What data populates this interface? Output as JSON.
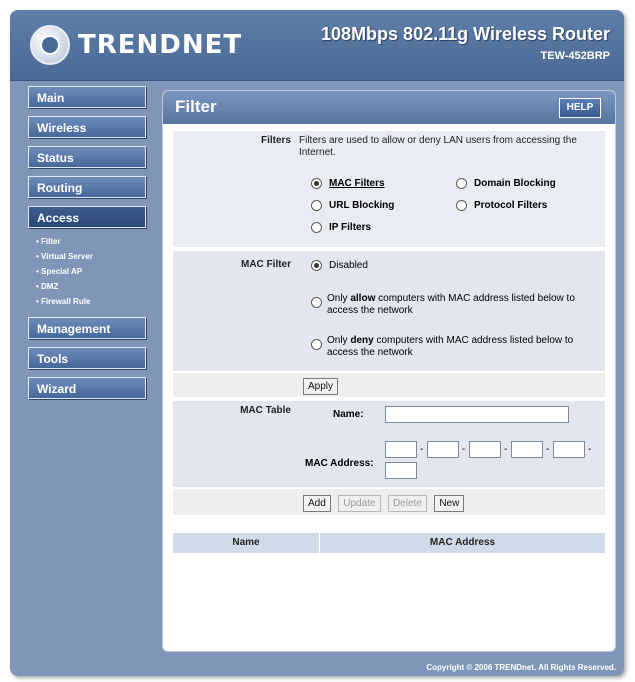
{
  "header": {
    "logo_text": "TRENDNET",
    "product_title": "108Mbps 802.11g Wireless Router",
    "model": "TEW-452BRP"
  },
  "sidebar": {
    "items": [
      {
        "label": "Main"
      },
      {
        "label": "Wireless"
      },
      {
        "label": "Status"
      },
      {
        "label": "Routing"
      },
      {
        "label": "Access"
      },
      {
        "label": "Management"
      },
      {
        "label": "Tools"
      },
      {
        "label": "Wizard"
      }
    ],
    "access_subitems": [
      {
        "label": "Filter"
      },
      {
        "label": "Virtual Server"
      },
      {
        "label": "Special AP"
      },
      {
        "label": "DMZ"
      },
      {
        "label": "Firewall Rule"
      }
    ]
  },
  "panel": {
    "title": "Filter",
    "help_label": "HELP",
    "filters_label": "Filters",
    "filters_description": "Filters are used to allow or deny LAN users from accessing the Internet.",
    "filter_options": {
      "mac": "MAC Filters",
      "domain": "Domain Blocking",
      "url": "URL Blocking",
      "protocol": "Protocol Filters",
      "ip": "IP Filters"
    },
    "mac_filter_label": "MAC Filter",
    "mac_filter_options": {
      "disabled": "Disabled",
      "allow_prefix": "Only",
      "allow_bold": "allow",
      "allow_suffix": "computers with MAC address listed below to access the network",
      "deny_prefix": "Only",
      "deny_bold": "deny",
      "deny_suffix": "computers with MAC address listed below to access the network"
    },
    "apply_label": "Apply",
    "mac_table_label": "MAC Table",
    "name_label": "Name:",
    "mac_address_label": "MAC Address:",
    "buttons": {
      "add": "Add",
      "update": "Update",
      "delete": "Delete",
      "new": "New"
    },
    "table_headers": {
      "name": "Name",
      "mac_address": "MAC Address"
    }
  },
  "footer": {
    "copyright": "Copyright © 2006 TRENDnet. All Rights Reserved."
  }
}
